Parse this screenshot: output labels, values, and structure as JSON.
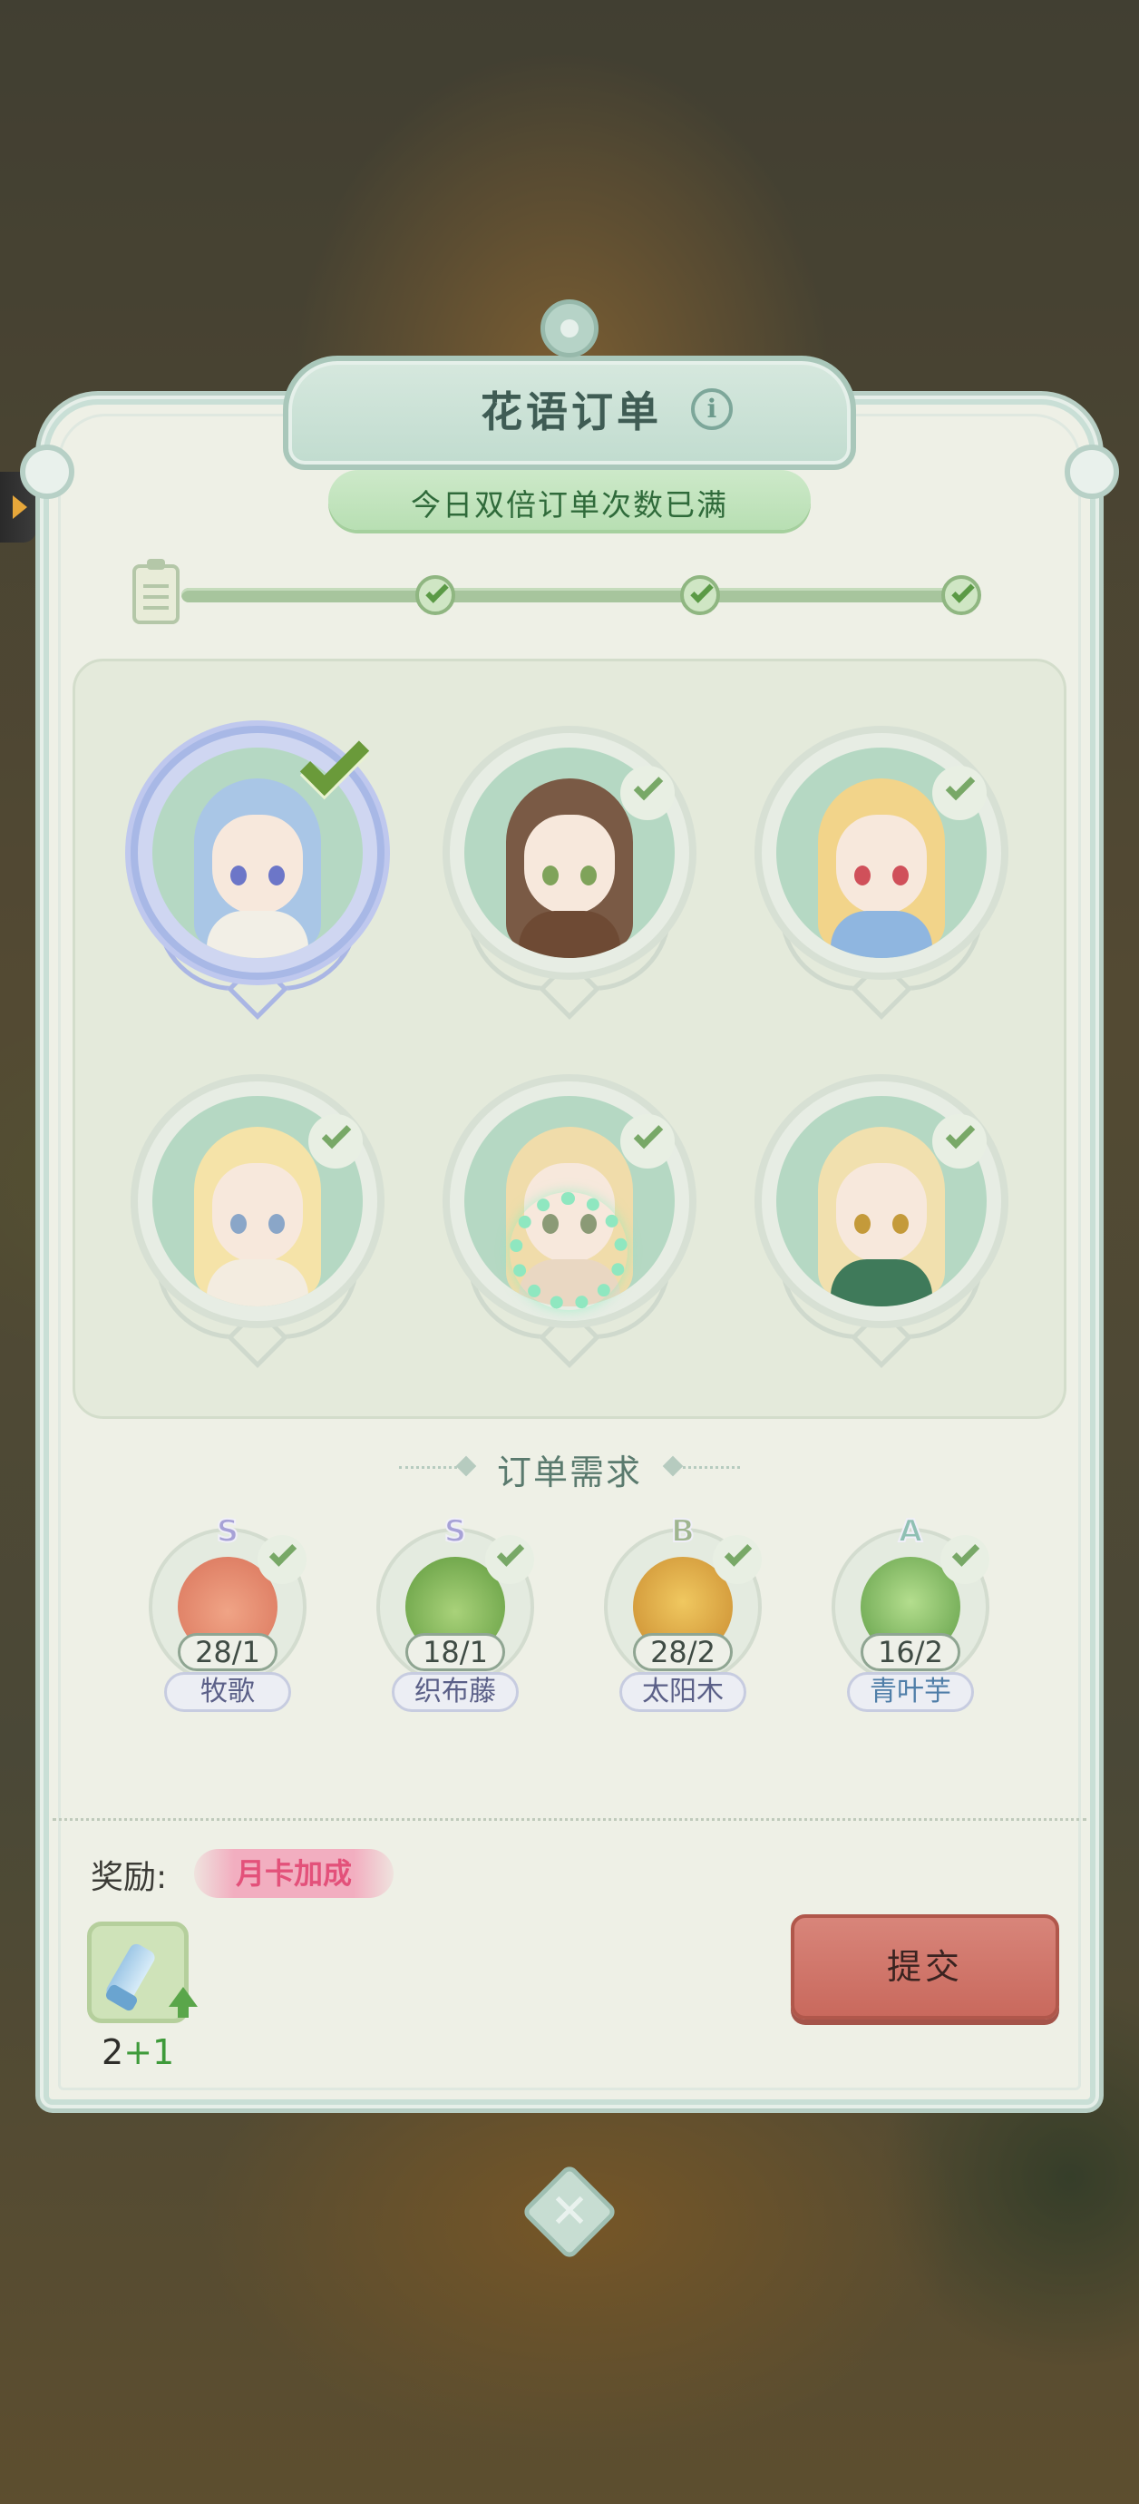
{
  "dialog": {
    "title": "花语订单",
    "notice": "今日双倍订单次数已满"
  },
  "progress": {
    "checkpoints_completed": 3,
    "checkpoints_total": 3
  },
  "characters": [
    {
      "id": 1,
      "completed": true,
      "selected": true,
      "hair": "#a9c6e6"
    },
    {
      "id": 2,
      "completed": true,
      "selected": false,
      "hair": "#7a5a45"
    },
    {
      "id": 3,
      "completed": true,
      "selected": false,
      "hair": "#f2d48a"
    },
    {
      "id": 4,
      "completed": true,
      "selected": false,
      "hair": "#f5e3a8"
    },
    {
      "id": 5,
      "completed": true,
      "selected": false,
      "hair": "#f0dcaa",
      "loading": true
    },
    {
      "id": 6,
      "completed": true,
      "selected": false,
      "hair": "#f1e0ae"
    }
  ],
  "requirements": {
    "title": "订单需求",
    "items": [
      {
        "grade": "S",
        "count": "28/1",
        "name": "牧歌",
        "completed": true,
        "art_color": "#e88a6b"
      },
      {
        "grade": "S",
        "count": "18/1",
        "name": "织布藤",
        "completed": true,
        "art_color": "#6b9e4a"
      },
      {
        "grade": "B",
        "count": "28/2",
        "name": "太阳木",
        "completed": true,
        "art_color": "#e0a23a"
      },
      {
        "grade": "A",
        "count": "16/2",
        "name": "青叶芋",
        "completed": true,
        "art_color": "#74b05a"
      }
    ]
  },
  "reward": {
    "label": "奖励:",
    "bonus_tag": "月卡加成",
    "item_icon": "paint-tube-icon",
    "count_base": "2",
    "count_bonus": "+1"
  },
  "actions": {
    "submit_label": "提交",
    "close_icon": "close-icon"
  },
  "colors": {
    "panel": "#eef0e6",
    "accent_green": "#78a867",
    "submit": "#c9695d"
  }
}
